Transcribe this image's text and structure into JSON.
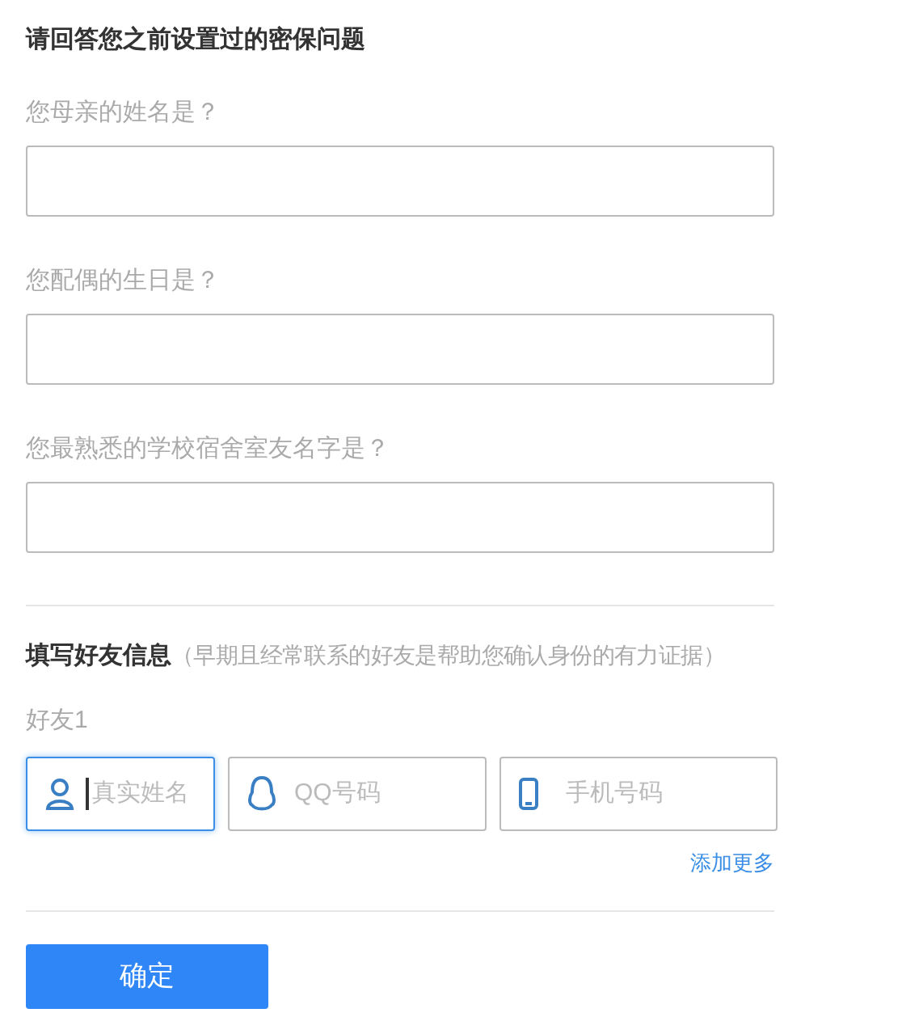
{
  "security": {
    "title": "请回答您之前设置过的密保问题",
    "questions": [
      {
        "label": "您母亲的姓名是？"
      },
      {
        "label": "您配偶的生日是？"
      },
      {
        "label": "您最熟悉的学校宿舍室友名字是？"
      }
    ]
  },
  "friends": {
    "title": "填写好友信息",
    "note": "（早期且经常联系的好友是帮助您确认身份的有力证据）",
    "friend_label": "好友1",
    "fields": [
      {
        "kind": "person",
        "placeholder": "真实姓名",
        "focused": true
      },
      {
        "kind": "qq",
        "placeholder": "QQ号码",
        "focused": false
      },
      {
        "kind": "phone",
        "placeholder": "手机号码",
        "focused": false
      }
    ],
    "add_more": "添加更多"
  },
  "confirm_button": "确定"
}
